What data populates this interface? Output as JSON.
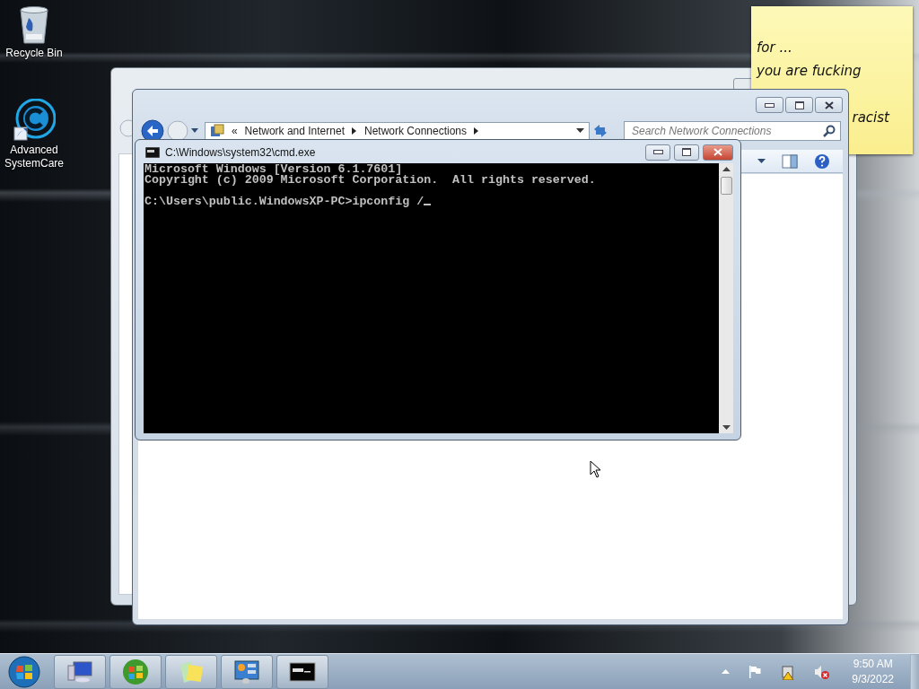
{
  "desktop_icons": [
    {
      "kind": "recycle_bin",
      "label": "Recycle Bin"
    },
    {
      "kind": "app_shortcut",
      "label": "Advanced SystemCare"
    }
  ],
  "sticky_note": {
    "lines": [
      {
        "kind": "full",
        "text": "for ..."
      },
      {
        "kind": "full",
        "text": "you are fucking"
      },
      {
        "kind": "tail",
        "text": "racist"
      }
    ]
  },
  "explorer_window": {
    "breadcrumb": [
      {
        "kind": "overflow",
        "text": "«"
      },
      {
        "kind": "crumb",
        "text": "Network and Internet"
      },
      {
        "kind": "crumb",
        "text": "Network Connections"
      }
    ],
    "search": {
      "placeholder": "Search Network Connections"
    }
  },
  "cmd_window": {
    "title": "C:\\Windows\\system32\\cmd.exe",
    "lines": [
      {
        "kind": "output",
        "text": "Microsoft Windows [Version 6.1.7601]"
      },
      {
        "kind": "output",
        "text": "Copyright (c) 2009 Microsoft Corporation.  All rights reserved."
      },
      {
        "kind": "prompt",
        "text": "C:\\Users\\public.WindowsXP-PC>ipconfig /"
      }
    ]
  },
  "taskbar": {
    "buttons": [
      {
        "kind": "computer"
      },
      {
        "kind": "media"
      },
      {
        "kind": "notes"
      },
      {
        "kind": "control_panel"
      },
      {
        "kind": "console"
      }
    ],
    "tray": {
      "icons": [
        {
          "kind": "arrow"
        },
        {
          "kind": "flag"
        },
        {
          "kind": "network"
        },
        {
          "kind": "speaker"
        }
      ],
      "time": "9:50 AM",
      "date": "9/3/2022"
    }
  }
}
